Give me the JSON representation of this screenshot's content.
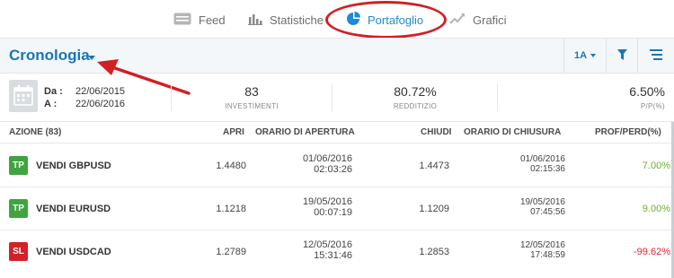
{
  "tabs": [
    {
      "label": "Feed",
      "icon": "feed-icon"
    },
    {
      "label": "Statistiche",
      "icon": "stats-icon"
    },
    {
      "label": "Portafoglio",
      "icon": "pie-chart-icon",
      "active": true
    },
    {
      "label": "Grafici",
      "icon": "chart-icon"
    }
  ],
  "header": {
    "title": "Cronologia",
    "period": "1A",
    "filter_icon": "filter-icon",
    "list_icon": "list-icon"
  },
  "stats": {
    "from_label": "Da :",
    "from_date": "22/06/2015",
    "to_label": "A :",
    "to_date": "22/06/2016",
    "investments_value": "83",
    "investments_label": "INVESTIMENTI",
    "yield_value": "80.72%",
    "yield_label": "REDDITIZIO",
    "pp_value": "6.50%",
    "pp_label": "P/P(%)"
  },
  "table": {
    "headers": {
      "azione": "AZIONE (83)",
      "apri": "APRI",
      "orario_apertura": "ORARIO DI APERTURA",
      "chiudi": "CHIUDI",
      "orario_chiusura": "ORARIO DI CHIUSURA",
      "prof_perd": "PROF/PERD(%)"
    },
    "rows": [
      {
        "badge": "TP",
        "badge_color": "#3fa43f",
        "symbol": "VENDI GBPUSD",
        "open": "1.4480",
        "open_date": "01/06/2016",
        "open_time": "02:03:26",
        "close": "1.4473",
        "close_date": "01/06/2016",
        "close_time": "02:15:36",
        "pl": "7.00%",
        "pl_color": "#6ab12d"
      },
      {
        "badge": "TP",
        "badge_color": "#3fa43f",
        "symbol": "VENDI EURUSD",
        "open": "1.1218",
        "open_date": "19/05/2016",
        "open_time": "00:07:19",
        "close": "1.1209",
        "close_date": "19/05/2016",
        "close_time": "07:45:56",
        "pl": "9.00%",
        "pl_color": "#6ab12d"
      },
      {
        "badge": "SL",
        "badge_color": "#d42027",
        "symbol": "VENDI USDCAD",
        "open": "1.2789",
        "open_date": "12/05/2016",
        "open_time": "15:31:46",
        "close": "1.2853",
        "close_date": "12/05/2016",
        "close_time": "17:48:59",
        "pl": "-99.62%",
        "pl_color": "#e0262b"
      }
    ]
  }
}
